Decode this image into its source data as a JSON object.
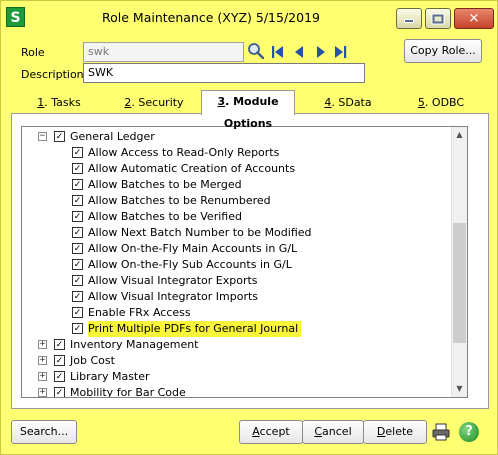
{
  "window": {
    "app_icon_letter": "S",
    "title": "Role Maintenance (XYZ) 5/15/2019",
    "accent_color": "#ffff72"
  },
  "form": {
    "role_label": "Role",
    "role_value": "swk",
    "description_label": "Description",
    "description_value": "SWK",
    "copy_role_label": "Copy Role..."
  },
  "tabs": [
    {
      "key": "1",
      "label": ". Tasks"
    },
    {
      "key": "2",
      "label": ". Security Events"
    },
    {
      "key": "3",
      "label": ". Module Options"
    },
    {
      "key": "4",
      "label": ". SData Security"
    },
    {
      "key": "5",
      "label": ". ODBC Security"
    }
  ],
  "active_tab": "3. Module Options",
  "tree": {
    "items": [
      {
        "label": "General Ledger",
        "expanded": true,
        "checked": true
      },
      {
        "label": "Allow Access to Read-Only Reports",
        "checked": true
      },
      {
        "label": "Allow Automatic Creation of Accounts",
        "checked": true
      },
      {
        "label": "Allow Batches to be Merged",
        "checked": true
      },
      {
        "label": "Allow Batches to be Renumbered",
        "checked": true
      },
      {
        "label": "Allow Batches to be Verified",
        "checked": true
      },
      {
        "label": "Allow Next Batch Number to be Modified",
        "checked": true
      },
      {
        "label": "Allow On-the-Fly Main Accounts in G/L",
        "checked": true
      },
      {
        "label": "Allow On-the-Fly Sub Accounts in G/L",
        "checked": true
      },
      {
        "label": "Allow Visual Integrator Exports",
        "checked": true
      },
      {
        "label": "Allow Visual Integrator Imports",
        "checked": true
      },
      {
        "label": "Enable FRx Access",
        "checked": true
      },
      {
        "label": "Print Multiple PDFs for General Journal",
        "checked": true,
        "highlighted": true
      },
      {
        "label": "Inventory Management",
        "expanded": false,
        "checked": true
      },
      {
        "label": "Job Cost",
        "expanded": false,
        "checked": true
      },
      {
        "label": "Library Master",
        "expanded": false,
        "checked": true
      },
      {
        "label": "Mobility for Bar Code",
        "expanded": false,
        "checked": true
      }
    ]
  },
  "buttons": {
    "search": "Search...",
    "accept_key": "A",
    "accept_rest": "ccept",
    "cancel_key": "C",
    "cancel_rest": "ancel",
    "delete_key": "D",
    "delete_rest": "elete",
    "help": "?"
  },
  "icons": {
    "lookup": "magnifier-icon",
    "first": "nav-first-icon",
    "prev": "nav-prev-icon",
    "next": "nav-next-icon",
    "last": "nav-last-icon",
    "print": "printer-icon",
    "help": "help-icon"
  }
}
